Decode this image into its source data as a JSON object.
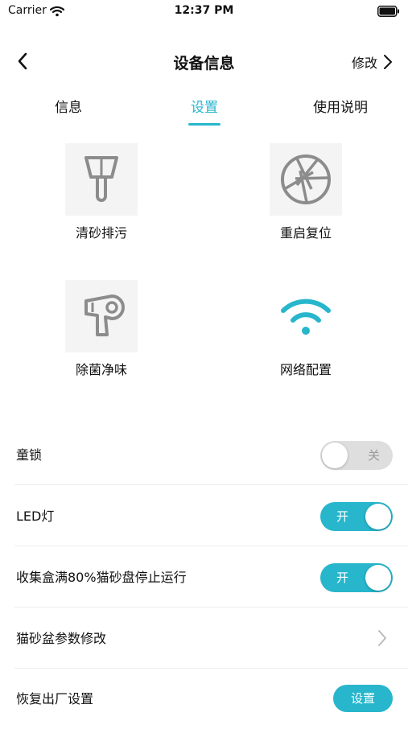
{
  "status_bar": {
    "carrier": "Carrier",
    "time": "12:37 PM"
  },
  "nav": {
    "title": "设备信息",
    "edit_label": "修改"
  },
  "tabs": [
    {
      "label": "信息",
      "active": false
    },
    {
      "label": "设置",
      "active": true
    },
    {
      "label": "使用说明",
      "active": false
    }
  ],
  "functions": [
    {
      "label": "清砂排污",
      "icon": "shovel-icon"
    },
    {
      "label": "重启复位",
      "icon": "aperture-icon"
    },
    {
      "label": "除菌净味",
      "icon": "hair-dryer-icon"
    },
    {
      "label": "网络配置",
      "icon": "wifi-icon"
    }
  ],
  "settings": {
    "child_lock": {
      "label": "童锁",
      "state": "关",
      "on": false
    },
    "led": {
      "label": "LED灯",
      "state": "开",
      "on": true
    },
    "stop_when_full": {
      "label": "收集盒满80%猫砂盘停止运行",
      "state": "开",
      "on": true
    },
    "litter_params": {
      "label": "猫砂盆参数修改"
    },
    "factory_reset": {
      "label": "恢复出厂设置",
      "button": "设置"
    }
  },
  "colors": {
    "accent": "#27b6cc",
    "toggle_off": "#dedede",
    "icon_gray": "#8c8c8c",
    "divider": "#ececec"
  }
}
